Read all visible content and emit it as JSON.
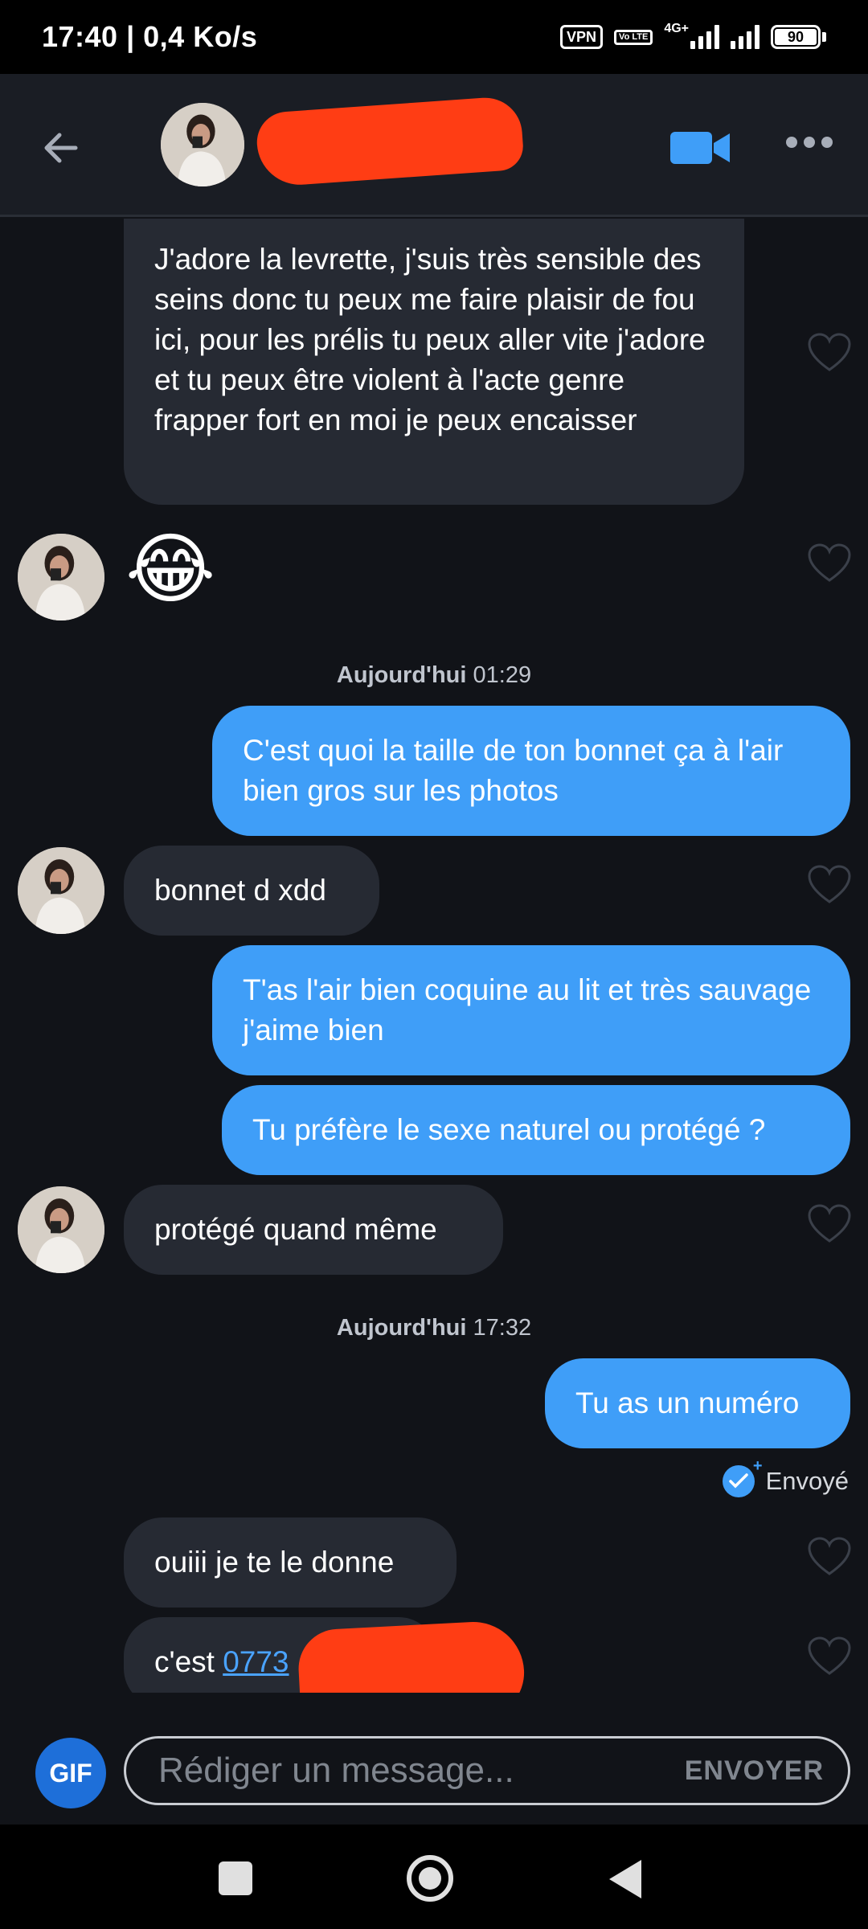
{
  "status_bar": {
    "time": "17:40 | 0,4 Ko/s",
    "vpn": "VPN",
    "volte": "Vo LTE",
    "network": "4G+",
    "battery": "90"
  },
  "header": {
    "back_icon": "arrow-left-icon",
    "video_icon": "video-camera-icon",
    "more_icon": "more-dots-icon",
    "accent": "#3f9ef8"
  },
  "messages": {
    "m1": "J'adore la levrette, j'suis très sensible des seins donc tu peux me faire plaisir de fou ici, pour les prélis tu peux aller vite j'adore et tu peux être violent à l'acte genre frapper fort en moi je peux encaisser",
    "m2_emoji": "😂",
    "stamp1_day": "Aujourd'hui",
    "stamp1_time": "01:29",
    "m3": "C'est quoi la taille de ton bonnet ça à l'air bien gros sur les photos",
    "m4": "bonnet d xdd",
    "m5": "T'as l'air bien coquine au lit et très sauvage j'aime bien",
    "m6": "Tu préfère le sexe naturel ou protégé ?",
    "m7": "protégé quand même",
    "stamp2_day": "Aujourd'hui",
    "stamp2_time": "17:32",
    "m8": "Tu as un numéro",
    "sent_status": "Envoyé",
    "m9": "ouiii je te le donne",
    "m10_prefix": "c'est ",
    "m10_link": "0773"
  },
  "composer": {
    "gif_label": "GIF",
    "placeholder": "Rédiger un message...",
    "send_label": "ENVOYER"
  },
  "colors": {
    "background": "#111318",
    "incoming_bubble": "#262a33",
    "outgoing_bubble": "#3f9ef8",
    "redaction": "#ff3d14"
  }
}
